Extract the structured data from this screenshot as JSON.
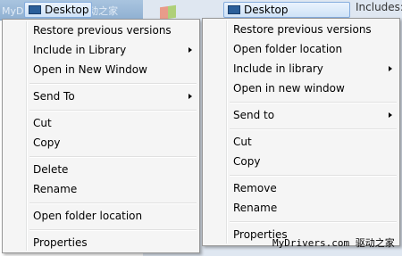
{
  "left": {
    "ghost_text": "MyDrivers.com 驱动之家",
    "desktop_label": "Desktop",
    "items": [
      "Restore previous versions",
      "Include in Library",
      "Open in New Window",
      "Send To",
      "Cut",
      "Copy",
      "Delete",
      "Rename",
      "Open folder location",
      "Properties"
    ]
  },
  "right": {
    "desktop_label": "Desktop",
    "includes_label": "Includes:",
    "items": [
      "Restore previous versions",
      "Open folder location",
      "Include in library",
      "Open in new window",
      "Send to",
      "Cut",
      "Copy",
      "Remove",
      "Rename",
      "Properties"
    ]
  },
  "watermark": "MyDrivers.com 驱动之家",
  "icons": {
    "desktop": "desktop-icon",
    "submenu": "submenu-arrow-icon",
    "windows": "windows-logo-icon"
  }
}
